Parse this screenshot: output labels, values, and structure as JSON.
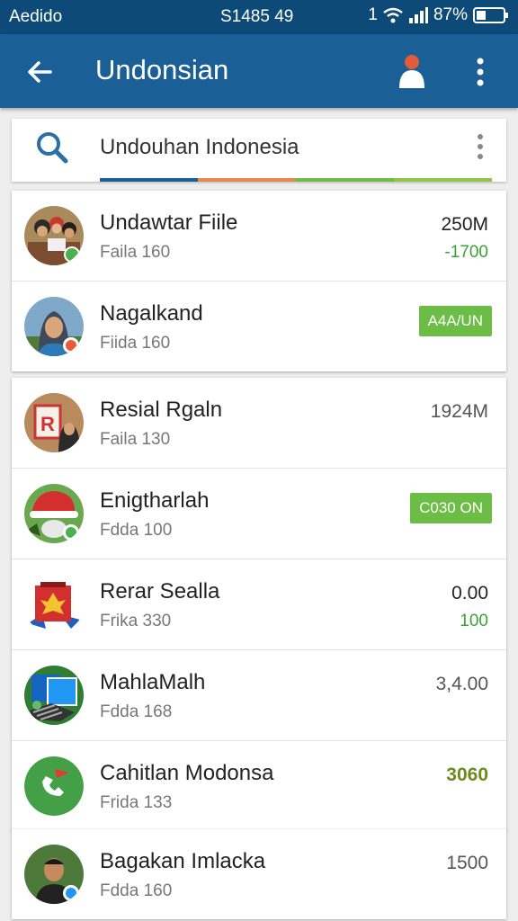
{
  "status_bar": {
    "left_text": "Aedido",
    "center_text": "S1485 49",
    "signal_text": "1",
    "battery_text": "87%"
  },
  "app_bar": {
    "title": "Undonsian"
  },
  "search": {
    "query": "Undouhan Indonesia"
  },
  "colors": {
    "status_bar": "#0d4a78",
    "app_bar": "#1b5f97",
    "badge_green": "#6cbd45",
    "delta_green": "#3aa335",
    "progress_segments": [
      "#1b5f97",
      "#e58a4e",
      "#6cbd45",
      "#8fc64a"
    ]
  },
  "groups": [
    {
      "items": [
        {
          "title": "Undawtar Fiile",
          "subtitle": "Faila 160",
          "value": "250M",
          "delta": "-1700",
          "avatar_icon": "family-photo-icon"
        },
        {
          "title": "Nagalkand",
          "subtitle": "Fiida 160",
          "badge": "A4A/UN",
          "avatar_icon": "woman-hijab-photo-icon"
        }
      ]
    },
    {
      "items": [
        {
          "title": "Resial Rgaln",
          "subtitle": "Faila 130",
          "value": "1924M",
          "avatar_icon": "document-r-icon"
        },
        {
          "title": "Enigtharlah",
          "subtitle": "Fdda 100",
          "badge": "C030 ON",
          "avatar_icon": "red-hat-icon"
        },
        {
          "title": "Rerar Sealla",
          "subtitle": "Frika 330",
          "value": "0.00",
          "delta": "100",
          "avatar_icon": "garuda-flag-icon"
        },
        {
          "title": "MahlaMalh",
          "subtitle": "Fdda 168",
          "value": "3,4.00",
          "avatar_icon": "photo-gallery-icon"
        },
        {
          "title": "Cahitlan Modonsa",
          "subtitle": "Frida 133",
          "value": "3060",
          "avatar_icon": "green-phone-icon"
        }
      ]
    },
    {
      "items": [
        {
          "title": "Bagakan Imlacka",
          "subtitle": "Fdda 160",
          "value": "1500",
          "avatar_icon": "man-portrait-icon"
        }
      ]
    }
  ]
}
